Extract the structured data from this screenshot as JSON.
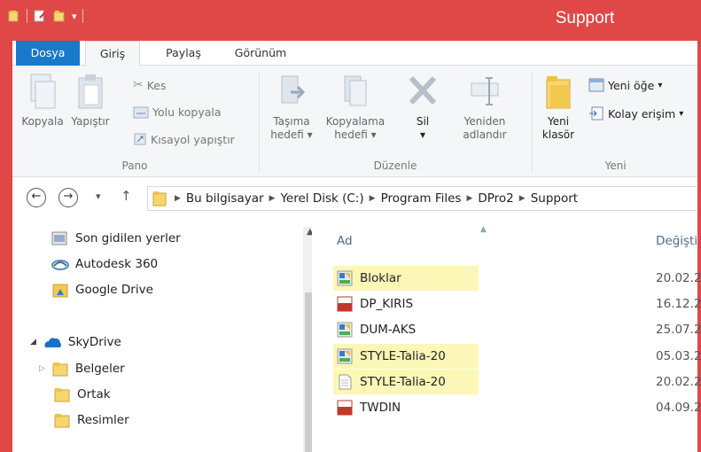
{
  "window": {
    "title": "Support"
  },
  "colors": {
    "titlebar": "#e04848",
    "file_tab": "#1979ca",
    "highlight": "#fcf7b6"
  },
  "ribbon_tabs": [
    {
      "label": "Dosya"
    },
    {
      "label": "Giriş"
    },
    {
      "label": "Paylaş"
    },
    {
      "label": "Görünüm"
    }
  ],
  "ribbon": {
    "pano": {
      "label": "Pano",
      "copy": "Kopyala",
      "paste": "Yapıştır",
      "cut": "Kes",
      "copy_path": "Yolu kopyala",
      "paste_shortcut": "Kısayol yapıştır"
    },
    "duzenle": {
      "label": "Düzenle",
      "move_to_1": "Taşıma",
      "move_to_2": "hedefi",
      "copy_to_1": "Kopyalama",
      "copy_to_2": "hedefi",
      "delete": "Sil",
      "rename_1": "Yeniden",
      "rename_2": "adlandır"
    },
    "yeni": {
      "label": "Yeni",
      "new_folder_1": "Yeni",
      "new_folder_2": "klasör",
      "new_item": "Yeni öğe",
      "easy_access": "Kolay erişim"
    }
  },
  "address": {
    "parts": [
      "Bu bilgisayar",
      "Yerel Disk (C:)",
      "Program Files",
      "DPro2",
      "Support"
    ]
  },
  "nav_pane": {
    "items": [
      {
        "label": "Son gidilen yerler",
        "icon": "recent-places-icon"
      },
      {
        "label": "Autodesk 360",
        "icon": "autodesk-cloud-icon"
      },
      {
        "label": "Google Drive",
        "icon": "google-drive-folder-icon"
      },
      {
        "label": "SkyDrive",
        "icon": "skydrive-icon"
      },
      {
        "label": "Belgeler",
        "icon": "folder-icon"
      },
      {
        "label": "Ortak",
        "icon": "folder-icon"
      },
      {
        "label": "Resimler",
        "icon": "folder-icon"
      }
    ]
  },
  "file_list": {
    "columns": {
      "name": "Ad",
      "date": "Değişti"
    },
    "rows": [
      {
        "name": "Bloklar",
        "date": "20.02.2",
        "icon": "dpro-file-icon",
        "highlighted": true
      },
      {
        "name": "DP_KIRIS",
        "date": "16.12.2",
        "icon": "cuix-file-icon",
        "highlighted": false
      },
      {
        "name": "DUM-AKS",
        "date": "25.07.2",
        "icon": "dpro-file-icon",
        "highlighted": false
      },
      {
        "name": "STYLE-Talia-20",
        "date": "05.03.2",
        "icon": "dpro-file-icon",
        "highlighted": true
      },
      {
        "name": "STYLE-Talia-20",
        "date": "20.02.2",
        "icon": "text-file-icon",
        "highlighted": true
      },
      {
        "name": "TWDIN",
        "date": "04.09.2",
        "icon": "shx-file-icon",
        "highlighted": false
      }
    ]
  }
}
